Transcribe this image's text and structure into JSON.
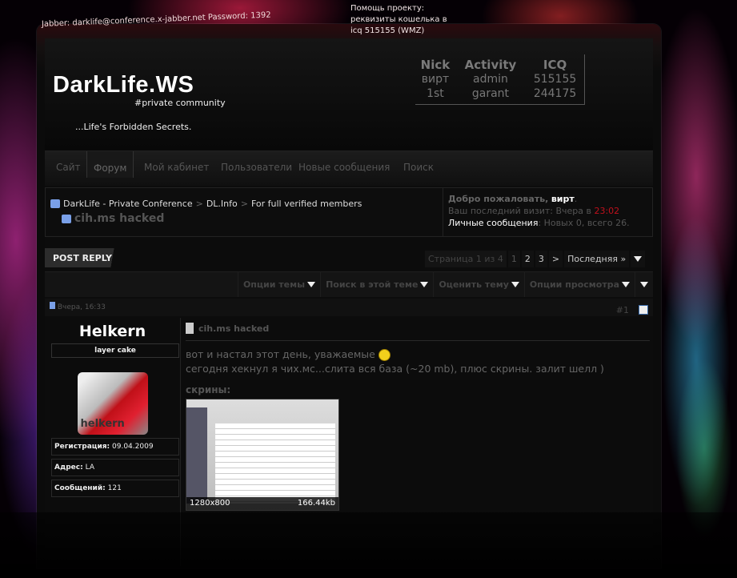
{
  "top": {
    "jabber": "Jabber: darklife@conference.x-jabber.net Password: 1392",
    "donate": [
      "Помощь проекту:",
      "реквизиты кошелька в",
      "icq 515155 (WMZ)"
    ]
  },
  "header": {
    "logo": "DarkLife.WS",
    "tagline": "#private community",
    "slogan": "...Life's Forbidden Secrets.",
    "staff": {
      "columns": [
        "Nick",
        "Activity",
        "ICQ"
      ],
      "rows": [
        [
          "вирт",
          "admin",
          "515155"
        ],
        [
          "1st",
          "garant",
          "244175"
        ]
      ]
    }
  },
  "nav": {
    "items": [
      "Сайт",
      "Форум",
      "Мой кабинет",
      "Пользователи",
      "Новые сообщения",
      "Поиск"
    ],
    "active": "Форум"
  },
  "breadcrumb": {
    "items": [
      "DarkLife - Private Conference",
      "DL.Info",
      "For full verified members"
    ],
    "separator": ">",
    "thread": "cih.ms hacked"
  },
  "welcome": {
    "greeting": "Добро пожаловать,",
    "nick": "вирт",
    "last_visit": "Ваш последний визит: Вчера в",
    "last_visit_time": "23:02",
    "pm_label": "Личные сообщения",
    "pm_text": ": Новых 0, всего 26."
  },
  "actions": {
    "post_reply": "POST REPLY"
  },
  "pager": {
    "label": "Страница 1 из 4",
    "pages": [
      "1",
      "2",
      "3"
    ],
    "next": ">",
    "last": "Последняя »"
  },
  "tools": [
    "Опции темы",
    "Поиск в этой теме",
    "Оценить тему",
    "Опции просмотра"
  ],
  "post": {
    "date": "Вчера, 16:33",
    "number": "#1",
    "user": {
      "name": "Helkern",
      "title": "layer cake",
      "avatar_text": "helkern",
      "fields": [
        {
          "label": "Регистрация:",
          "value": "09.04.2009"
        },
        {
          "label": "Адрес:",
          "value": "LA"
        },
        {
          "label": "Сообщений:",
          "value": "121"
        }
      ]
    },
    "title": "cih.ms hacked",
    "line1": "вот и настал этот день, уважаемые",
    "line2": "сегодня хекнул я чих.мс...слита вся база (~20 mb), плюс скрины. залит шелл )",
    "screens_label": "скрины:",
    "attachment": {
      "resolution": "1280x800",
      "size": "166.44kb"
    }
  }
}
